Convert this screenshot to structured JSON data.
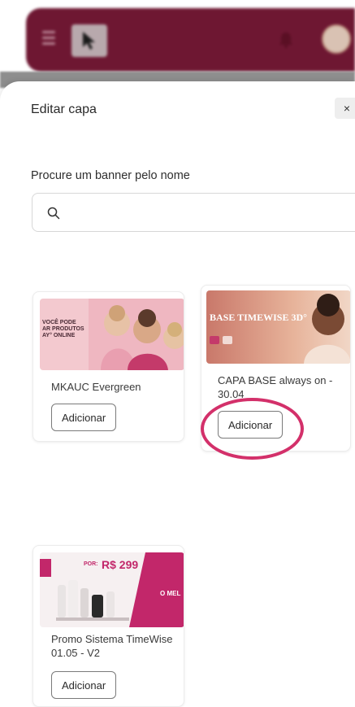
{
  "topbar": {
    "menu_icon": "hamburger-icon",
    "logo_icon": "cursor-arrow-icon",
    "bell_icon": "bell-icon",
    "avatar": "user-avatar",
    "bar_color": "#6e1732"
  },
  "dialog": {
    "title": "Editar capa",
    "close_label": "×",
    "search_label": "Procure um banner pelo nome",
    "search_placeholder": "",
    "search_icon": "search-icon"
  },
  "banners": [
    {
      "name": "MKAUC Evergreen",
      "button": "Adicionar",
      "thumb_text": "VOCÊ PODE\nAR PRODUTOS\nAY° ONLINE"
    },
    {
      "name": "CAPA BASE always on - 30.04",
      "button": "Adicionar",
      "thumb_text": "BASE TIMEWISE 3D°"
    },
    {
      "name": "Promo Sistema TimeWise 01.05 - V2",
      "button": "Adicionar",
      "thumb_price": "R$ 299",
      "thumb_price_prefix": "POR:",
      "thumb_tag": "O MEL"
    }
  ],
  "accent_colors": {
    "highlight": "#d3306a",
    "brand": "#6e1732"
  }
}
